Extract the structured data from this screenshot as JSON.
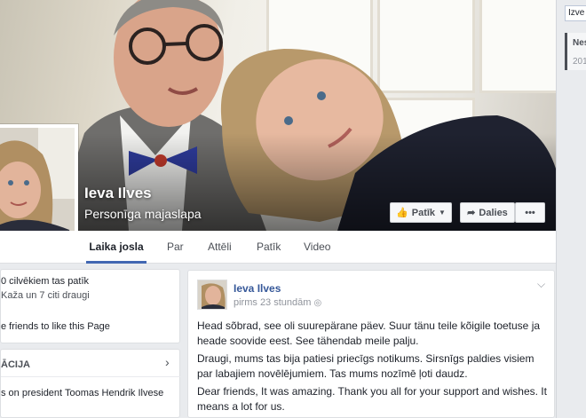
{
  "cover": {
    "name": "Ieva Ilves",
    "category": "Personīga majaslapa",
    "like_button": "Patīk",
    "share_button": "Dalies",
    "more_button": "•••"
  },
  "tabs": [
    "Laika josla",
    "Par",
    "Attēli",
    "Patīk",
    "Video"
  ],
  "right_panel": {
    "search_value": "Izve",
    "item_title": "Nes",
    "item_date": "201"
  },
  "left": {
    "likes_count": "0 cilvēkiem tas patīk",
    "likes_friends": "Kaža un 7 citi draugi",
    "invite": "e friends to like this Page",
    "section_title": "ĀCIJA",
    "about_text": "s on president Toomas Hendrik Ilvese"
  },
  "post": {
    "author": "Ieva Ilves",
    "time": "pirms 23 stundām",
    "paragraphs": [
      "Head sõbrad, see oli suurepärane päev. Suur tänu teile kõigile toetuse ja heade soovide eest. See tähendab meile palju.",
      "Draugi, mums tas bija patiesi priecīgs notikums. Sirsnīgs paldies visiem par labajiem novēlējumiem. Tas mums nozīmē ļoti daudz.",
      "Dear friends, It was amazing. Thank you all for your support and wishes. It means a lot for us."
    ]
  }
}
